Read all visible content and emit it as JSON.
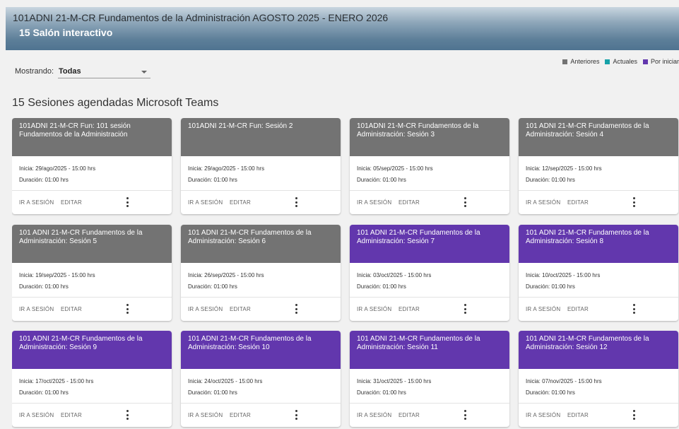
{
  "header": {
    "course_title": "101ADNI 21-M-CR Fundamentos de la Administración AGOSTO 2025 - ENERO 2026",
    "room_title": "15 Salón interactivo"
  },
  "legend": {
    "items": [
      {
        "label": "Anteriores",
        "color": "#737373"
      },
      {
        "label": "Actuales",
        "color": "#17a2a8"
      },
      {
        "label": "Por iniciar",
        "color": "#6237ad"
      }
    ]
  },
  "filter": {
    "label": "Mostrando:",
    "value": "Todas"
  },
  "section_title": "15 Sesiones agendadas Microsoft Teams",
  "card_actions": {
    "go_label": "IR A SESIÓN",
    "edit_label": "EDITAR"
  },
  "sessions": [
    {
      "title": "101ADNI 21-M-CR Fun: 101 sesión Fundamentos de la Administración",
      "start": "Inicia: 29/ago/2025 - 15:00 hrs",
      "duration": "Duración: 01:00 hrs",
      "status": "prev"
    },
    {
      "title": "101ADNI 21-M-CR Fun: Sesión 2",
      "start": "Inicia: 29/ago/2025 - 15:00 hrs",
      "duration": "Duración: 01:00 hrs",
      "status": "prev"
    },
    {
      "title": "101ADNI 21-M-CR Fundamentos de la Administración: Sesión 3",
      "start": "Inicia: 05/sep/2025 - 15:00 hrs",
      "duration": "Duración: 01:00 hrs",
      "status": "prev"
    },
    {
      "title": "101 ADNI 21-M-CR Fundamentos de la Administración: Sesión 4",
      "start": "Inicia: 12/sep/2025 - 15:00 hrs",
      "duration": "Duración: 01:00 hrs",
      "status": "prev"
    },
    {
      "title": "101 ADNI 21-M-CR Fundamentos de la Administración: Sesión 5",
      "start": "Inicia: 19/sep/2025 - 15:00 hrs",
      "duration": "Duración: 01:00 hrs",
      "status": "prev"
    },
    {
      "title": "101 ADNI 21-M-CR Fundamentos de la Administración: Sesión 6",
      "start": "Inicia: 26/sep/2025 - 15:00 hrs",
      "duration": "Duración: 01:00 hrs",
      "status": "prev"
    },
    {
      "title": "101 ADNI 21-M-CR Fundamentos de la Administración: Sesión 7",
      "start": "Inicia: 03/oct/2025 - 15:00 hrs",
      "duration": "Duración: 01:00 hrs",
      "status": "next"
    },
    {
      "title": "101 ADNI 21-M-CR Fundamentos de la Administración: Sesión 8",
      "start": "Inicia: 10/oct/2025 - 15:00 hrs",
      "duration": "Duración: 01:00 hrs",
      "status": "next"
    },
    {
      "title": "101 ADNI 21-M-CR Fundamentos de la Administración: Sesión 9",
      "start": "Inicia: 17/oct/2025 - 15:00 hrs",
      "duration": "Duración: 01:00 hrs",
      "status": "next"
    },
    {
      "title": "101 ADNI 21-M-CR Fundamentos de la Administración: Sesión 10",
      "start": "Inicia: 24/oct/2025 - 15:00 hrs",
      "duration": "Duración: 01:00 hrs",
      "status": "next"
    },
    {
      "title": "101 ADNI 21-M-CR Fundamentos de la Administración: Sesión 11",
      "start": "Inicia: 31/oct/2025 - 15:00 hrs",
      "duration": "Duración: 01:00 hrs",
      "status": "next"
    },
    {
      "title": "101 ADNI 21-M-CR Fundamentos de la Administración: Sesión 12",
      "start": "Inicia: 07/nov/2025 - 15:00 hrs",
      "duration": "Duración: 01:00 hrs",
      "status": "next"
    }
  ]
}
